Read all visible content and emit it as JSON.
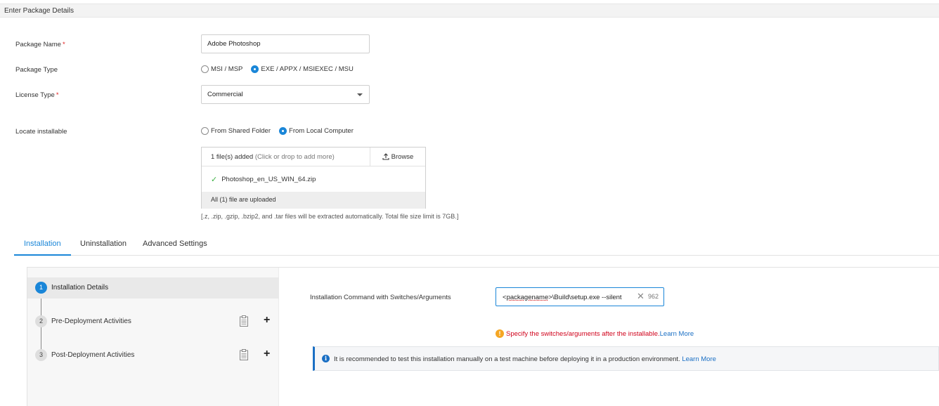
{
  "section_header": {
    "title": "Enter Package Details"
  },
  "form": {
    "package_name": {
      "label": "Package Name",
      "required_mark": "*",
      "value": "Adobe Photoshop"
    },
    "package_type": {
      "label": "Package Type",
      "options": [
        {
          "label": "MSI / MSP",
          "selected": false
        },
        {
          "label": "EXE / APPX / MSIEXEC / MSU",
          "selected": true
        }
      ]
    },
    "license_type": {
      "label": "License Type",
      "required_mark": "*",
      "value": "Commercial"
    },
    "locate_installable": {
      "label": "Locate installable",
      "options": [
        {
          "label": "From Shared Folder",
          "selected": false
        },
        {
          "label": "From Local Computer",
          "selected": true
        }
      ]
    },
    "upload": {
      "count_text": "1 file(s) added",
      "hint": "(Click or drop to add more)",
      "browse_label": "Browse",
      "file_name": "Photoshop_en_US_WIN_64.zip",
      "status_text": "All (1) file are uploaded",
      "note": "[.z, .zip, .gzip, .bzip2, and .tar files will be extracted automatically. Total file size limit is 7GB.]"
    }
  },
  "tabs": [
    {
      "label": "Installation",
      "active": true
    },
    {
      "label": "Uninstallation",
      "active": false
    },
    {
      "label": "Advanced Settings",
      "active": false
    }
  ],
  "steps": [
    {
      "number": "1",
      "label": "Installation Details",
      "active": true
    },
    {
      "number": "2",
      "label": "Pre-Deployment Activities",
      "active": false
    },
    {
      "number": "3",
      "label": "Post-Deployment Activities",
      "active": false
    }
  ],
  "installation": {
    "command_label": "Installation Command with Switches/Arguments",
    "command_prefix": "<",
    "command_placeholder_word": "packagename",
    "command_suffix": ">\\Build\\setup.exe --silent",
    "char_count": "962",
    "warning_text": "Specify the switches/arguments after the installable.",
    "warning_link": "Learn More",
    "info_text": "It is recommended to test this installation manually on a test machine before deploying it in a production environment.",
    "info_link": "Learn More"
  },
  "colors": {
    "accent": "#1a86d8",
    "link": "#1a6fc4",
    "warning": "#f5a623",
    "error_text": "#d0021b",
    "success": "#3bb143"
  }
}
